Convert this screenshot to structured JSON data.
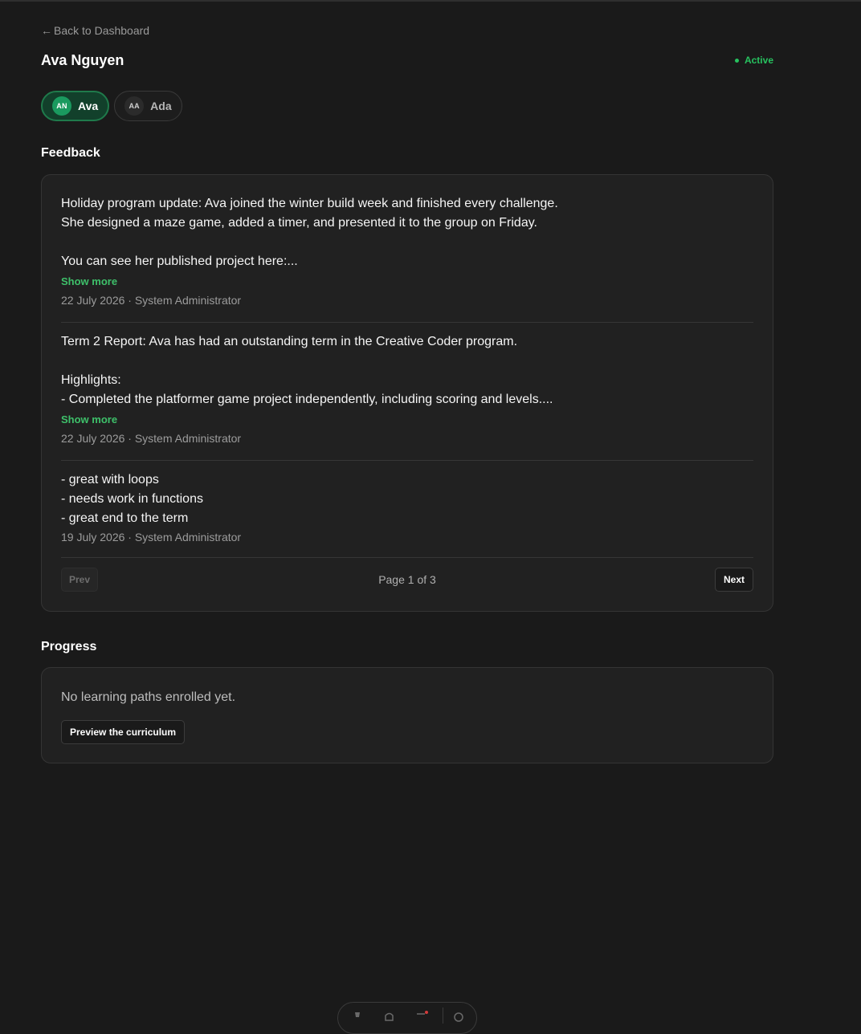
{
  "nav": {
    "back_label": "Back to Dashboard",
    "back_icon": "left-arrow-icon"
  },
  "student": {
    "name": "Ava Nguyen",
    "status": "Active",
    "status_color": "#27c25f"
  },
  "switcher": [
    {
      "initials": "AN",
      "name": "Ava",
      "active": true
    },
    {
      "initials": "AA",
      "name": "Ada",
      "active": false
    }
  ],
  "feedback": {
    "heading": "Feedback",
    "entries": [
      {
        "body": "Holiday program update: Ava joined the winter build week and finished every challenge.\nShe designed a maze game, added a timer, and presented it to the group on Friday.\n\nYou can see her published project here:...",
        "show_more": "Show more",
        "meta": "22 July 2026 · System Administrator"
      },
      {
        "body": "Term 2 Report: Ava has had an outstanding term in the Creative Coder program.\n\nHighlights:\n- Completed the platformer game project independently, including scoring and levels....",
        "show_more": "Show more",
        "meta": "22 July 2026 · System Administrator"
      },
      {
        "body": "- great with loops\n- needs work in functions\n- great end to the term",
        "meta": "19 July 2026 · System Administrator"
      }
    ],
    "pager": {
      "prev": "Prev",
      "next": "Next",
      "page_text": "Page 1 of 3"
    }
  },
  "progress": {
    "heading": "Progress",
    "empty_text": "No learning paths enrolled yet.",
    "preview_button": "Preview the curriculum"
  },
  "colors": {
    "accent": "#3ec06a",
    "background": "#1a1a1a",
    "card": "#212121"
  }
}
